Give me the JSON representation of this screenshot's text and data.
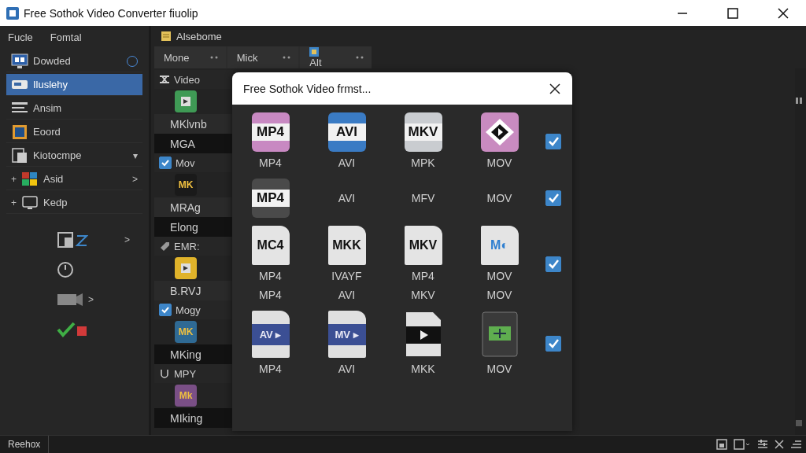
{
  "window": {
    "title": "Free Sothok Video Converter fiuolip"
  },
  "menu": [
    {
      "label": "Fucle"
    },
    {
      "label": "Fomtal"
    }
  ],
  "sidebar": {
    "items": [
      {
        "label": "Dowded",
        "kind": "monitor",
        "radio": false,
        "selected": false
      },
      {
        "label": "Iluslehy",
        "kind": "drive",
        "selected": true
      },
      {
        "label": "Ansim",
        "kind": "lines",
        "selected": false
      },
      {
        "label": "Eoord",
        "kind": "frame",
        "selected": false
      },
      {
        "label": "Kiotocmpe",
        "kind": "doc",
        "trail": "▾",
        "selected": false
      },
      {
        "label": "Asid",
        "kind": "blocks",
        "prefix": "+",
        "trail": ">",
        "selected": false
      },
      {
        "label": "Kedp",
        "kind": "screen",
        "prefix": "+",
        "selected": false
      }
    ],
    "tools": [
      {
        "kind": "panel",
        "trail": ">"
      },
      {
        "kind": "clock"
      },
      {
        "kind": "camera",
        "trail": ">"
      },
      {
        "kind": "check"
      }
    ]
  },
  "library": {
    "title": "Alsebome",
    "toolbar": [
      {
        "label": "Mone"
      },
      {
        "label": "Mick"
      },
      {
        "label": "Alt",
        "kind": "icon"
      }
    ],
    "entries": [
      {
        "kind": "section",
        "label": "Video"
      },
      {
        "kind": "thumb",
        "color": "#3f9a55"
      },
      {
        "kind": "label",
        "label": "MKlvnb",
        "shaded": false
      },
      {
        "kind": "label",
        "label": "MGA",
        "shaded": true
      },
      {
        "kind": "check",
        "label": "Mov",
        "checked": true
      },
      {
        "kind": "thumb",
        "color": "#1a1a1a",
        "text": "MK"
      },
      {
        "kind": "label",
        "label": "MRAg",
        "shaded": false
      },
      {
        "kind": "label",
        "label": "Elong",
        "shaded": true
      },
      {
        "kind": "section",
        "label": "EMR:"
      },
      {
        "kind": "thumb",
        "color": "#e0b32a"
      },
      {
        "kind": "label",
        "label": "B.RVJ",
        "shaded": false
      },
      {
        "kind": "check",
        "label": "Mogy",
        "checked": true
      },
      {
        "kind": "thumb",
        "color": "#2f6a94",
        "text": "MK"
      },
      {
        "kind": "label",
        "label": "MKing",
        "shaded": true
      },
      {
        "kind": "section",
        "label": "MPY"
      },
      {
        "kind": "thumb",
        "color": "#7a4f86",
        "text": "Mk"
      },
      {
        "kind": "label",
        "label": "MIking",
        "shaded": true
      }
    ]
  },
  "dialog": {
    "title": "Free Sothok Video frmst...",
    "rows": [
      {
        "checked": true,
        "cells": [
          {
            "icon": {
              "kind": "tile",
              "color": "#c889c2",
              "text": "MP4"
            },
            "captions": [
              "MP4"
            ]
          },
          {
            "icon": {
              "kind": "tile",
              "color": "#3a7bc4",
              "text": "AVI"
            },
            "captions": [
              "AVI"
            ]
          },
          {
            "icon": {
              "kind": "tile",
              "color": "#c9ccd0",
              "text": "MKV"
            },
            "captions": [
              "MPK"
            ]
          },
          {
            "icon": {
              "kind": "diamond",
              "color": "#c98bc0"
            },
            "captions": [
              "MOV"
            ]
          }
        ]
      },
      {
        "checked": true,
        "cells": [
          {
            "icon": {
              "kind": "tile",
              "color": "#4a4a4a",
              "text": "MP4"
            }
          },
          {
            "captions": [
              "AVI"
            ]
          },
          {
            "captions": [
              "MFV"
            ]
          },
          {
            "captions": [
              "MOV"
            ]
          }
        ]
      },
      {
        "checked": true,
        "cells": [
          {
            "icon": {
              "kind": "doc",
              "text": "MC4"
            },
            "captions": [
              "MP4",
              "MP4"
            ]
          },
          {
            "icon": {
              "kind": "doc",
              "text": "MKK"
            },
            "captions": [
              "IVAYF",
              "AVI"
            ]
          },
          {
            "icon": {
              "kind": "doc",
              "text": "MKV"
            },
            "captions": [
              "MP4",
              "MKV"
            ]
          },
          {
            "icon": {
              "kind": "doc",
              "text": "M◐",
              "color": "#2f7fd0"
            },
            "captions": [
              "MOV",
              "MOV"
            ]
          }
        ]
      },
      {
        "checked": true,
        "cells": [
          {
            "icon": {
              "kind": "band",
              "color": "#3b4f94",
              "text": "AV ▸"
            },
            "captions": [
              "MP4"
            ]
          },
          {
            "icon": {
              "kind": "band",
              "color": "#3b4f94",
              "text": "MV ▸"
            },
            "captions": [
              "AVI"
            ]
          },
          {
            "icon": {
              "kind": "play"
            },
            "captions": [
              "MKK"
            ]
          },
          {
            "icon": {
              "kind": "screen"
            },
            "captions": [
              "MOV"
            ]
          }
        ]
      }
    ]
  },
  "status_bar": {
    "text": "Reehox"
  }
}
